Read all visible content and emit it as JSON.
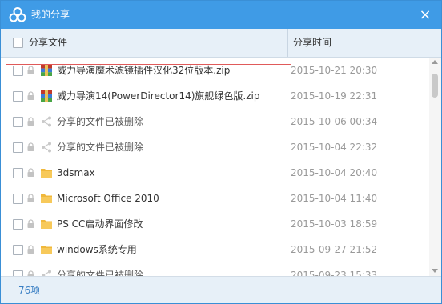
{
  "window": {
    "title": "我的分享",
    "close_glyph": "×"
  },
  "header": {
    "name_label": "分享文件",
    "time_label": "分享时间"
  },
  "rows": [
    {
      "name": "威力导演魔术滤镜插件汉化32位版本.zip",
      "time": "2015-10-21 20:30",
      "icon": "winrar-archive-icon"
    },
    {
      "name": "威力导演14(PowerDirector14)旗舰绿色版.zip",
      "time": "2015-10-19 22:31",
      "icon": "winrar-archive-icon"
    },
    {
      "name": "分享的文件已被删除",
      "time": "2015-10-06 00:34",
      "icon": "share-icon"
    },
    {
      "name": "分享的文件已被删除",
      "time": "2015-10-04 22:32",
      "icon": "share-icon"
    },
    {
      "name": "3dsmax",
      "time": "2015-10-04 20:40",
      "icon": "folder-icon"
    },
    {
      "name": "Microsoft Office 2010",
      "time": "2015-10-04 11:40",
      "icon": "folder-icon"
    },
    {
      "name": "PS CC启动界面修改",
      "time": "2015-10-03 18:59",
      "icon": "folder-icon"
    },
    {
      "name": "windows系统专用",
      "time": "2015-09-27 21:52",
      "icon": "folder-icon"
    },
    {
      "name": "分享的文件已被删除",
      "time": "2015-09-23 15:33",
      "icon": "share-icon"
    }
  ],
  "footer": {
    "count": "76项"
  },
  "colors": {
    "title_bar": "#3f9be6",
    "header_bg": "#e7f0f8",
    "highlight_border": "#e05a5a",
    "count_text": "#3a7fc4"
  }
}
